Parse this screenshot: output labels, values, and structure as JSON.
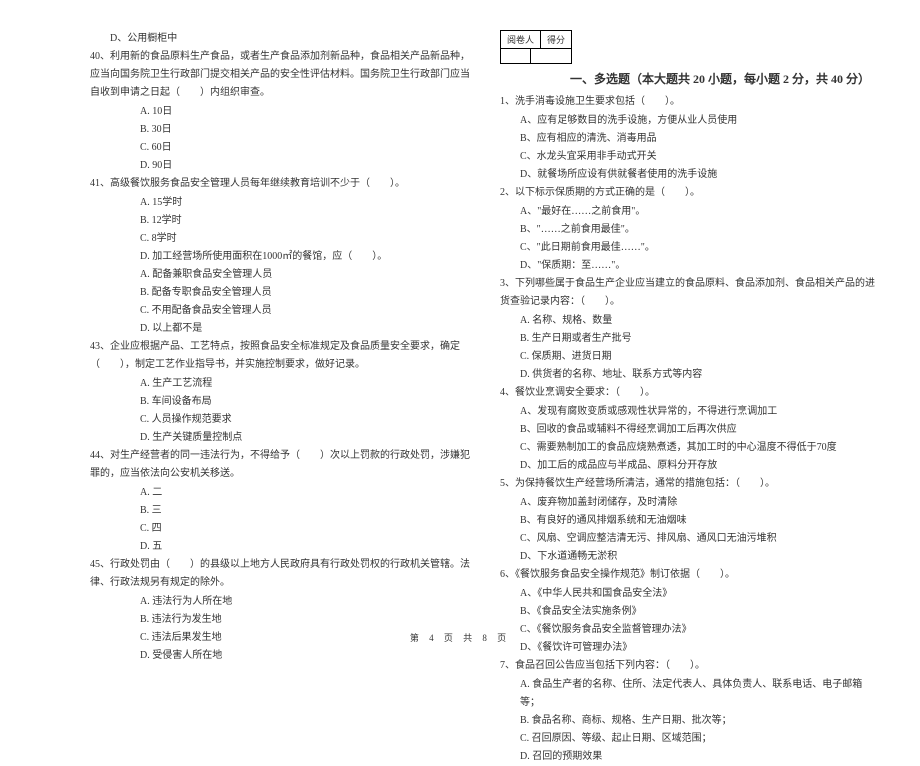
{
  "left": {
    "optD_39": "D、公用橱柜中",
    "q40": "40、利用新的食品原料生产食品，或者生产食品添加剂新品种，食品相关产品新品种，应当向国务院卫生行政部门提交相关产品的安全性评估材料。国务院卫生行政部门应当自收到申请之日起（　　）内组织审查。",
    "q40a": "A. 10日",
    "q40b": "B. 30日",
    "q40c": "C. 60日",
    "q40d": "D. 90日",
    "q41": "41、高级餐饮服务食品安全管理人员每年继续教育培训不少于（　　）。",
    "q41a": "A. 15学时",
    "q41b": "B. 12学时",
    "q41c": "C. 8学时",
    "q41d": "D. 加工经营场所使用面积在1000㎡的餐馆，应（　　）。",
    "q42a2": "A. 配备兼职食品安全管理人员",
    "q42b2": "B. 配备专职食品安全管理人员",
    "q42c2": "C. 不用配备食品安全管理人员",
    "q42d2": "D. 以上都不是",
    "q43": "43、企业应根据产品、工艺特点，按照食品安全标准规定及食品质量安全要求，确定（　　），制定工艺作业指导书，并实施控制要求，做好记录。",
    "q43a": "A. 生产工艺流程",
    "q43b": "B. 车间设备布局",
    "q43c": "C. 人员操作规范要求",
    "q43d": "D. 生产关键质量控制点",
    "q44": "44、对生产经营者的同一违法行为，不得给予（　　）次以上罚款的行政处罚，涉嫌犯罪的，应当依法向公安机关移送。",
    "q44a": "A. 二",
    "q44b": "B. 三",
    "q44c": "C. 四",
    "q44d": "D. 五",
    "q45": "45、行政处罚由（　　）的县级以上地方人民政府具有行政处罚权的行政机关管辖。法律、行政法规另有规定的除外。",
    "q45a": "A. 违法行为人所在地",
    "q45b": "B. 违法行为发生地",
    "q45c": "C. 违法后果发生地",
    "q45d": "D. 受侵害人所在地"
  },
  "right": {
    "score_l1": "阅卷人",
    "score_l2": "得分",
    "section": "一、多选题（本大题共 20 小题，每小题 2 分，共 40 分）",
    "q1": "1、洗手消毒设施卫生要求包括（　　）。",
    "q1a": "A、应有足够数目的洗手设施，方便从业人员使用",
    "q1b": "B、应有相应的清洗、消毒用品",
    "q1c": "C、水龙头宜采用非手动式开关",
    "q1d": "D、就餐场所应设有供就餐者使用的洗手设施",
    "q2": "2、以下标示保质期的方式正确的是（　　）。",
    "q2a": "A、\"最好在……之前食用\"。",
    "q2b": "B、\"……之前食用最佳\"。",
    "q2c": "C、\"此日期前食用最佳……\"。",
    "q2d": "D、\"保质期：至……\"。",
    "q3": "3、下列哪些属于食品生产企业应当建立的食品原料、食品添加剂、食品相关产品的进货查验记录内容：（　　）。",
    "q3a": "A. 名称、规格、数量",
    "q3b": "B. 生产日期或者生产批号",
    "q3c": "C. 保质期、进货日期",
    "q3d": "D. 供货者的名称、地址、联系方式等内容",
    "q4": "4、餐饮业烹调安全要求：（　　）。",
    "q4a": "A、发现有腐败变质或感观性状异常的，不得进行烹调加工",
    "q4b": "B、回收的食品或辅料不得经烹调加工后再次供应",
    "q4c": "C、需要熟制加工的食品应烧熟煮透，其加工时的中心温度不得低于70度",
    "q4d": "D、加工后的成品应与半成品、原料分开存放",
    "q5": "5、为保持餐饮生产经营场所清洁，通常的措施包括：（　　）。",
    "q5a": "A、废弃物加盖封闭储存，及时清除",
    "q5b": "B、有良好的通风排烟系统和无油烟味",
    "q5c": "C、风扇、空调应整洁清无污、排风扇、通风口无油污堆积",
    "q5d": "D、下水道通畅无淤积",
    "q6": "6、《餐饮服务食品安全操作规范》制订依据（　　）。",
    "q6a": "A、《中华人民共和国食品安全法》",
    "q6b": "B、《食品安全法实施条例》",
    "q6c": "C、《餐饮服务食品安全监督管理办法》",
    "q6d": "D、《餐饮许可管理办法》",
    "q7": "7、食品召回公告应当包括下列内容：（　　）。",
    "q7a": "A. 食品生产者的名称、住所、法定代表人、具体负责人、联系电话、电子邮箱等；",
    "q7b": "B. 食品名称、商标、规格、生产日期、批次等；",
    "q7c": "C. 召回原因、等级、起止日期、区域范围；",
    "q7d": "D. 召回的预期效果"
  },
  "footer": "第 4 页 共 8 页"
}
